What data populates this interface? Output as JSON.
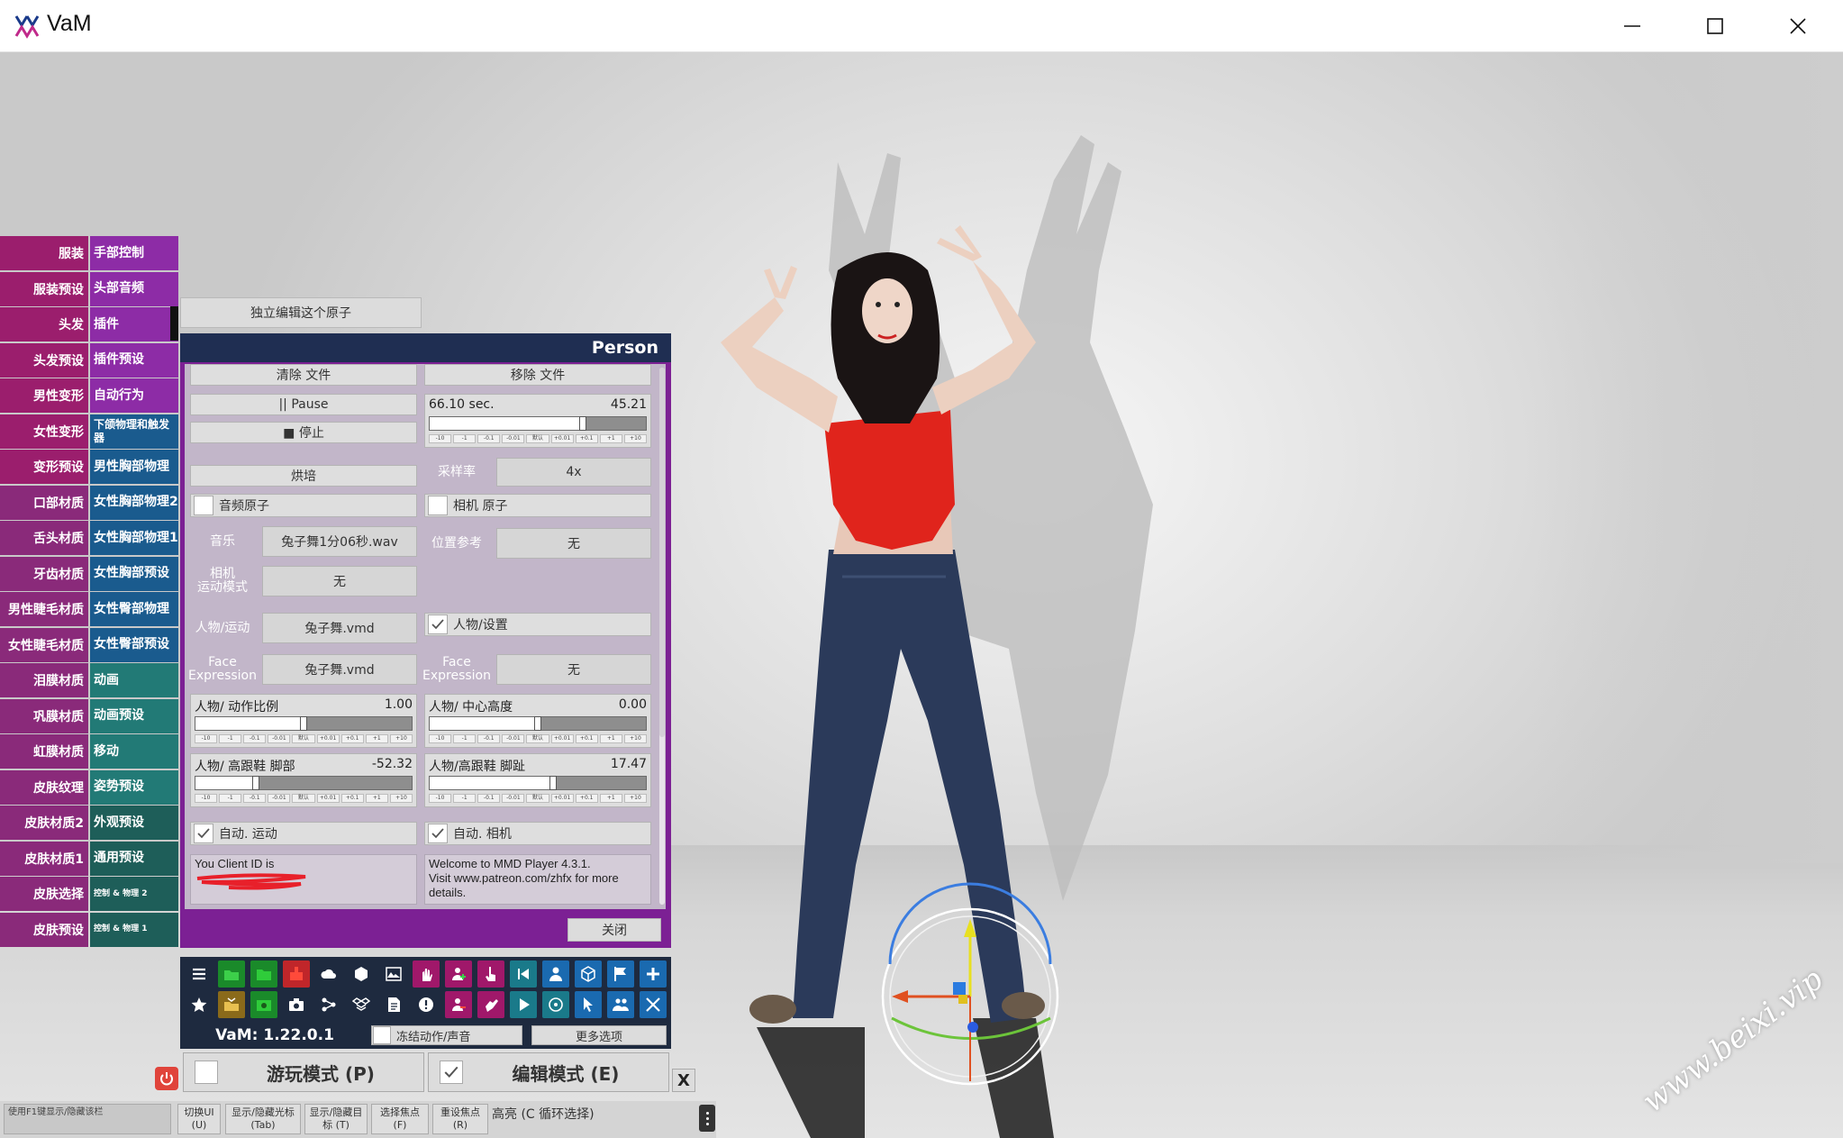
{
  "window": {
    "title": "VaM"
  },
  "watermark": "www.beixi.vip",
  "menu": {
    "rows": [
      {
        "left": "服装",
        "right": "手部控制",
        "lc": "c-mag",
        "rc": "c-pur"
      },
      {
        "left": "服装预设",
        "right": "头部音频",
        "lc": "c-mag",
        "rc": "c-pur"
      },
      {
        "left": "头发",
        "right": "插件",
        "lc": "c-mag",
        "rc": "c-pur"
      },
      {
        "left": "头发预设",
        "right": "插件预设",
        "lc": "c-mag",
        "rc": "c-pur"
      },
      {
        "left": "男性变形",
        "right": "自动行为",
        "lc": "c-mag",
        "rc": "c-pur"
      },
      {
        "left": "女性变形",
        "right": "下颌物理和触发器",
        "lc": "c-mag",
        "rc": "c-blu"
      },
      {
        "left": "变形预设",
        "right": "男性胸部物理",
        "lc": "c-mag",
        "rc": "c-blu"
      },
      {
        "left": "口部材质",
        "right": "女性胸部物理2",
        "lc": "c-mag2",
        "rc": "c-blu"
      },
      {
        "left": "舌头材质",
        "right": "女性胸部物理1",
        "lc": "c-mag2",
        "rc": "c-blu"
      },
      {
        "left": "牙齿材质",
        "right": "女性胸部预设",
        "lc": "c-mag2",
        "rc": "c-blu"
      },
      {
        "left": "男性睫毛材质",
        "right": "女性臀部物理",
        "lc": "c-mag2",
        "rc": "c-blu"
      },
      {
        "left": "女性睫毛材质",
        "right": "女性臀部预设",
        "lc": "c-mag2",
        "rc": "c-blu"
      },
      {
        "left": "泪膜材质",
        "right": "动画",
        "lc": "c-mag2",
        "rc": "c-tea"
      },
      {
        "left": "巩膜材质",
        "right": "动画预设",
        "lc": "c-mag2",
        "rc": "c-tea"
      },
      {
        "left": "虹膜材质",
        "right": "移动",
        "lc": "c-mag2",
        "rc": "c-tea"
      },
      {
        "left": "皮肤纹理",
        "right": "姿势预设",
        "lc": "c-mag2",
        "rc": "c-tea"
      },
      {
        "left": "皮肤材质2",
        "right": "外观预设",
        "lc": "c-mag2",
        "rc": "c-dtl"
      },
      {
        "left": "皮肤材质1",
        "right": "通用预设",
        "lc": "c-mag2",
        "rc": "c-dtl"
      },
      {
        "left": "皮肤选择",
        "right": "控制 & 物理 2",
        "lc": "c-mag2",
        "rc": "c-dtl"
      },
      {
        "left": "皮肤预设",
        "right": "控制 & 物理 1",
        "lc": "c-mag2",
        "rc": "c-dtl"
      }
    ]
  },
  "atom_edit_button": "独立编辑这个原子",
  "panel": {
    "title": "Person",
    "clear_file": "清除 文件",
    "remove_file": "移除 文件",
    "pause": "|| Pause",
    "stop": "■ 停止",
    "time_label": "66.10 sec.",
    "time_value": "45.21",
    "time_progress": 0.71,
    "bake": "烘培",
    "sample_rate_label": "采样率",
    "sample_rate_value": "4x",
    "audio_atom": "音频原子",
    "camera_atom": "相机 原子",
    "music_label": "音乐",
    "music_value": "兔子舞1分06秒.wav",
    "pos_ref_label": "位置参考",
    "pos_ref_value": "无",
    "camera_motion_label": "相机\n运动模式",
    "camera_motion_value": "无",
    "person_motion_label": "人物/运动",
    "person_motion_value": "兔子舞.vmd",
    "person_settings": "人物/设置",
    "face_label_left": "Face\nExpression",
    "face_value_left": "兔子舞.vmd",
    "face_label_right": "Face\nExpression",
    "face_value_right": "无",
    "motion_scale_label": "人物/ 动作比例",
    "motion_scale_value": "1.00",
    "motion_scale_progress": 0.5,
    "center_height_label": "人物/ 中心高度",
    "center_height_value": "0.00",
    "center_height_progress": 0.5,
    "heel_foot_label": "人物/ 高跟鞋 脚部",
    "heel_foot_value": "-52.32",
    "heel_foot_progress": 0.28,
    "heel_toe_label": "人物/高跟鞋 脚趾",
    "heel_toe_value": "17.47",
    "heel_toe_progress": 0.57,
    "auto_motion": "自动. 运动",
    "auto_camera": "自动. 相机",
    "client_id_text": "You Client ID is",
    "welcome_text": "Welcome to MMD Player 4.3.1.\nVisit www.patreon.com/zhfx for more details.",
    "close": "关闭",
    "steps": [
      "-10",
      "-1",
      "-0.1",
      "-0.01",
      "默认",
      "+0.01",
      "+0.1",
      "+1",
      "+10"
    ]
  },
  "toolbar": {
    "version": "VaM: 1.22.0.1",
    "freeze": "冻结动作/声音",
    "more_options": "更多选项"
  },
  "modes": {
    "play": "游玩模式 (P)",
    "edit": "编辑模式 (E)",
    "close_x": "X"
  },
  "bottom": {
    "hint_left": "使用F1键显示/隐藏该栏",
    "buttons": [
      "切换UI\n(U)",
      "显示/隐藏光标\n(Tab)",
      "显示/隐藏目标 (T)",
      "选择焦点\n(F)",
      "重设焦点\n(R)"
    ],
    "highlight": "高亮 (C 循环选择)"
  },
  "colors": {
    "panel_purple": "#7c2094",
    "panel_header": "#1f2e52",
    "toolbar_bg": "#1e2a3f",
    "menu_magenta": "#9b1e6d",
    "menu_purple": "#8d2ca6",
    "menu_blue": "#1a5b8e",
    "menu_teal": "#227a76",
    "power_red": "#e0443b"
  }
}
